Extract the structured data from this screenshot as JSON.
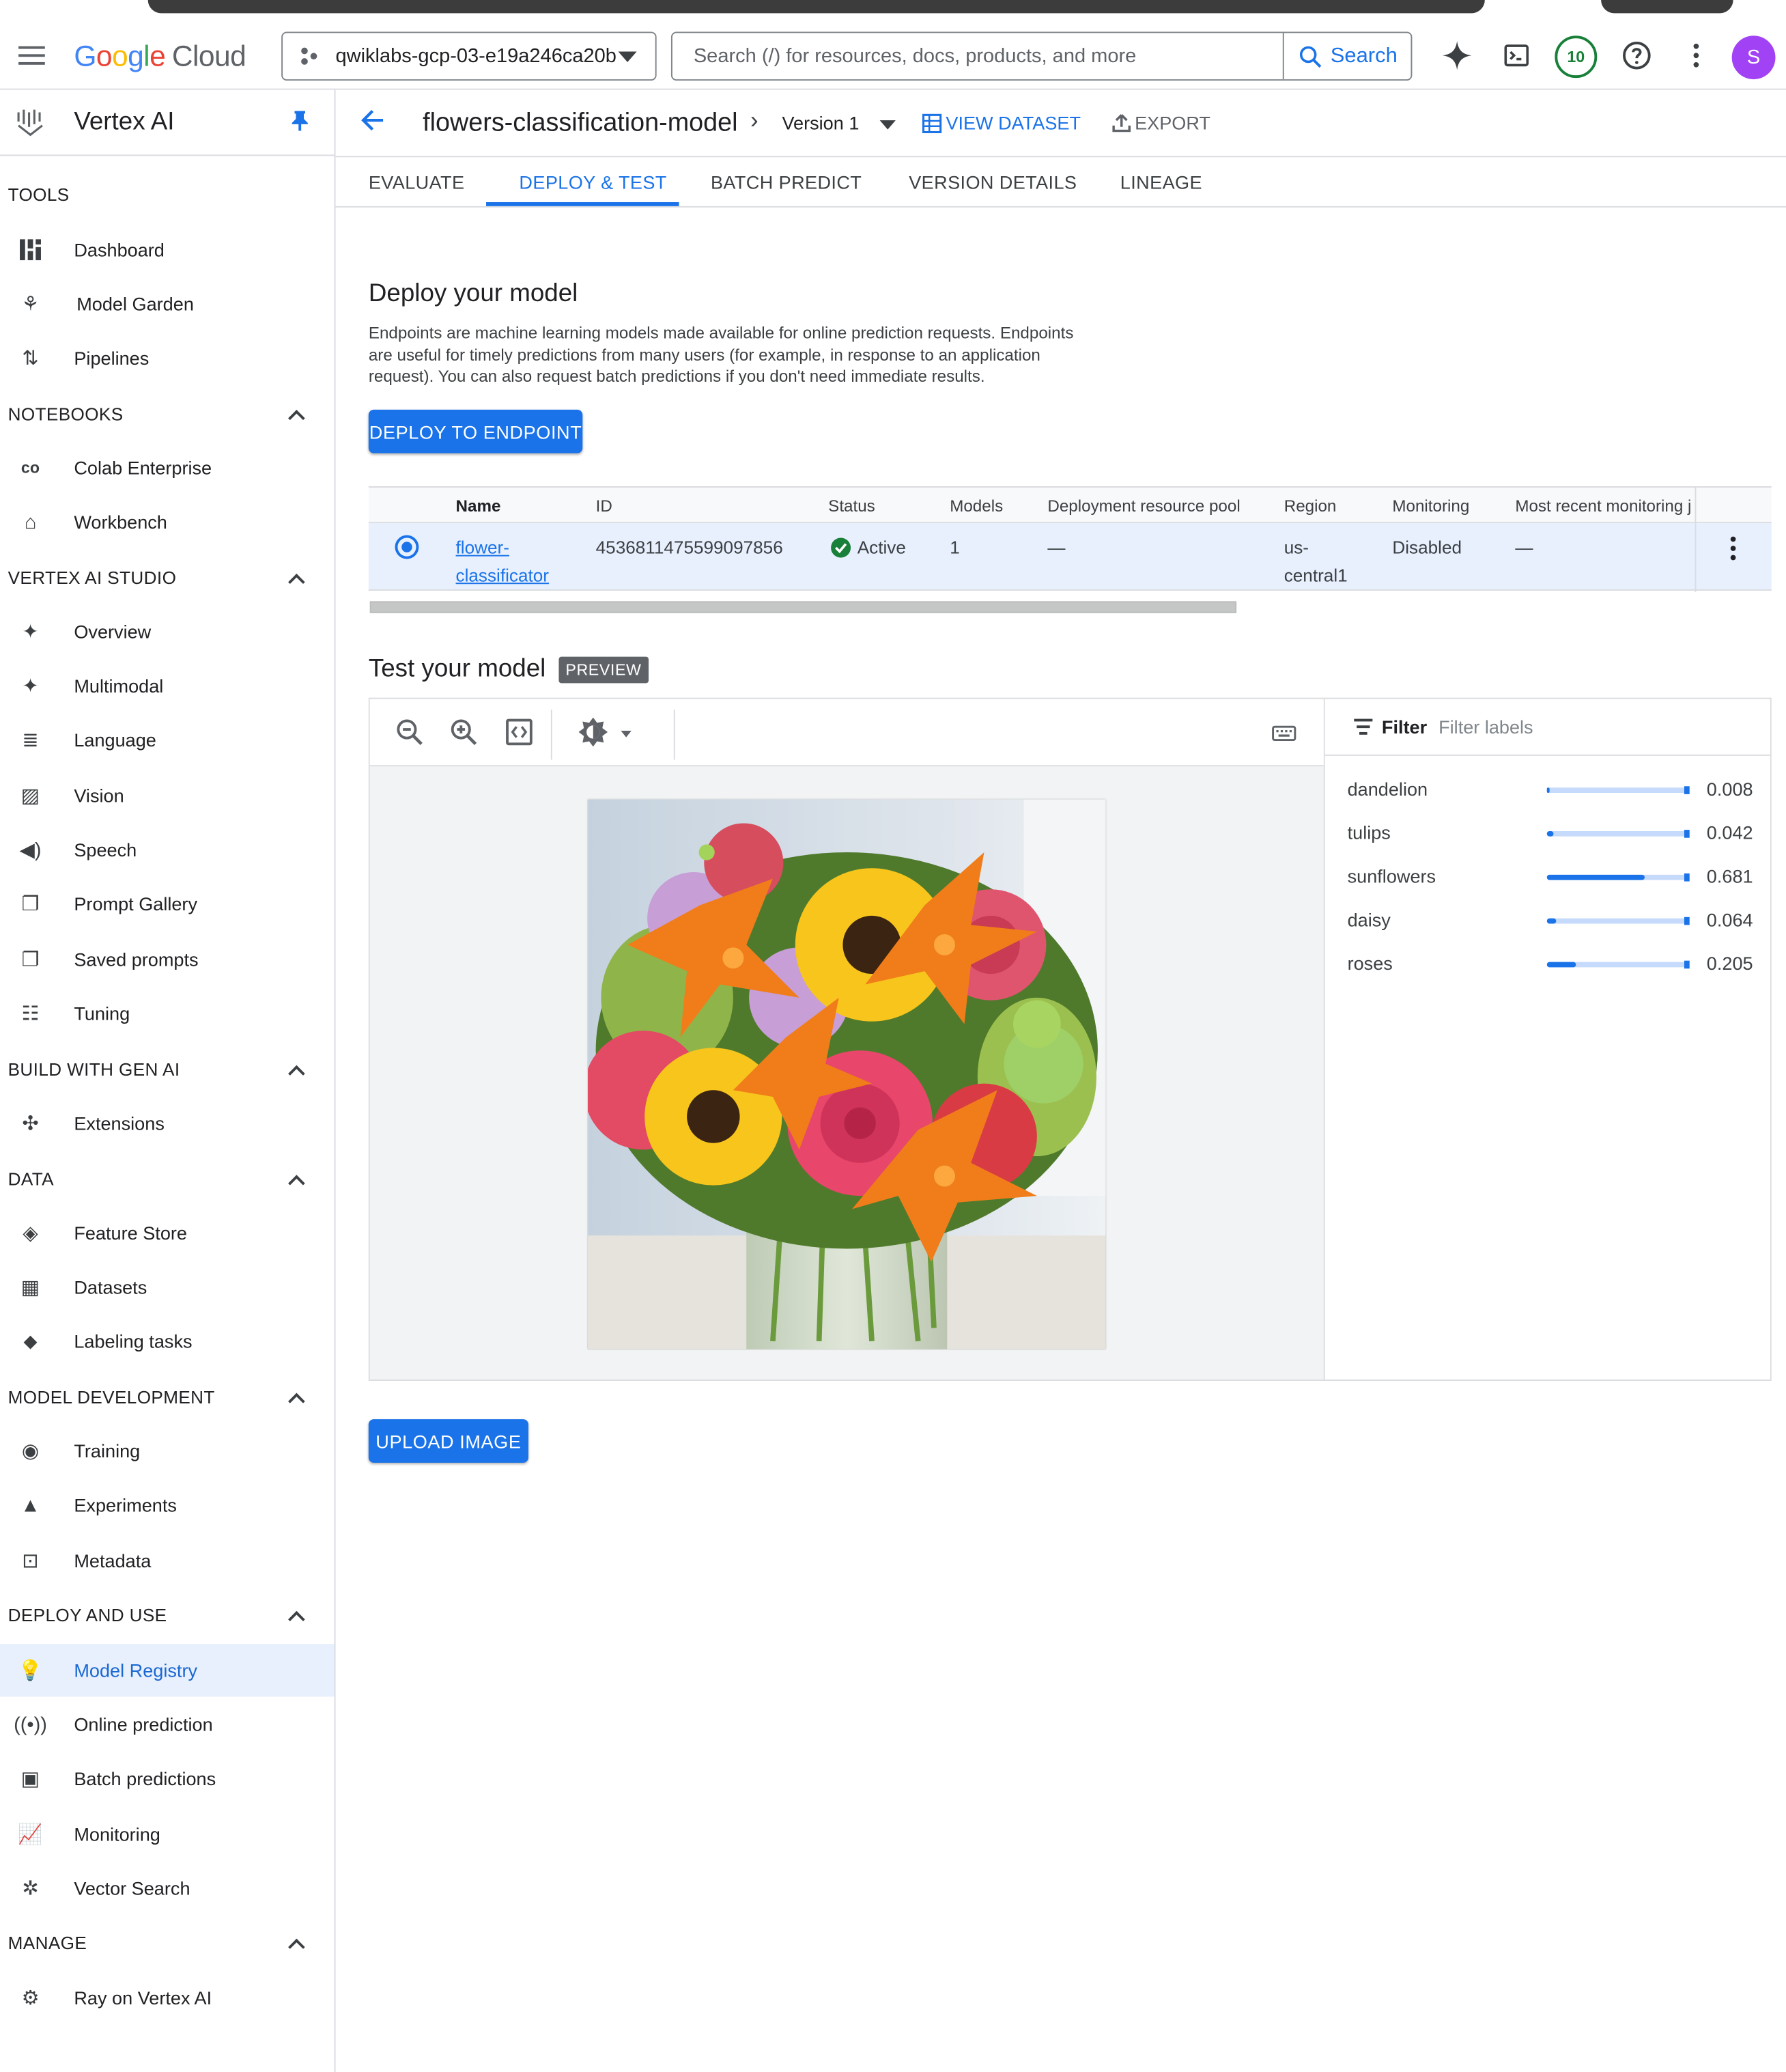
{
  "app": {
    "logo_google": "Google",
    "logo_cloud": "Cloud",
    "project": "qwiklabs-gcp-03-e19a246ca20b",
    "search_placeholder": "Search (/) for resources, docs, products, and more",
    "search_button": "Search",
    "notifications_count": "10",
    "avatar_letter": "S",
    "accent": "#1a73e8"
  },
  "sidebar": {
    "title": "Vertex AI",
    "sections": {
      "tools": "TOOLS",
      "notebooks": "NOTEBOOKS",
      "studio": "VERTEX AI STUDIO",
      "build": "BUILD WITH GEN AI",
      "data": "DATA",
      "model_dev": "MODEL DEVELOPMENT",
      "deploy": "DEPLOY AND USE",
      "manage": "MANAGE"
    },
    "items": {
      "dashboard": "Dashboard",
      "model_garden": "Model Garden",
      "pipelines": "Pipelines",
      "colab": "Colab Enterprise",
      "workbench": "Workbench",
      "overview": "Overview",
      "multimodal": "Multimodal",
      "language": "Language",
      "vision": "Vision",
      "speech": "Speech",
      "prompt_gallery": "Prompt Gallery",
      "saved_prompts": "Saved prompts",
      "tuning": "Tuning",
      "extensions": "Extensions",
      "feature_store": "Feature Store",
      "datasets": "Datasets",
      "labeling": "Labeling tasks",
      "training": "Training",
      "experiments": "Experiments",
      "metadata": "Metadata",
      "model_registry": "Model Registry",
      "online_prediction": "Online prediction",
      "batch_predictions": "Batch predictions",
      "monitoring": "Monitoring",
      "vector_search": "Vector Search",
      "ray": "Ray on Vertex AI"
    }
  },
  "header": {
    "model_name": "flowers-classification-model",
    "version": "Version 1",
    "view_dataset": "VIEW DATASET",
    "export": "EXPORT"
  },
  "tabs": [
    "EVALUATE",
    "DEPLOY & TEST",
    "BATCH PREDICT",
    "VERSION DETAILS",
    "LINEAGE"
  ],
  "deploy": {
    "title": "Deploy your model",
    "description": "Endpoints are machine learning models made available for online prediction requests. Endpoints are useful for timely predictions from many users (for example, in response to an application request). You can also request batch predictions if you don't need immediate results.",
    "button": "DEPLOY TO ENDPOINT"
  },
  "endpoints_table": {
    "columns": [
      "Name",
      "ID",
      "Status",
      "Models",
      "Deployment resource pool",
      "Region",
      "Monitoring",
      "Most recent monitoring j"
    ],
    "rows": [
      {
        "name_line1": "flower-",
        "name_line2": "classificator",
        "id": "4536811475599097856",
        "status": "Active",
        "models": "1",
        "pool": "—",
        "region_line1": "us-",
        "region_line2": "central1",
        "monitoring": "Disabled",
        "recent": "—"
      }
    ]
  },
  "test": {
    "title": "Test your model",
    "badge": "PREVIEW",
    "filter_label": "Filter",
    "filter_placeholder": "Filter labels",
    "predictions": [
      {
        "label": "dandelion",
        "score": "0.008",
        "fraction": 0.008
      },
      {
        "label": "tulips",
        "score": "0.042",
        "fraction": 0.042
      },
      {
        "label": "sunflowers",
        "score": "0.681",
        "fraction": 0.681
      },
      {
        "label": "daisy",
        "score": "0.064",
        "fraction": 0.064
      },
      {
        "label": "roses",
        "score": "0.205",
        "fraction": 0.205
      }
    ],
    "upload_button": "UPLOAD IMAGE"
  }
}
